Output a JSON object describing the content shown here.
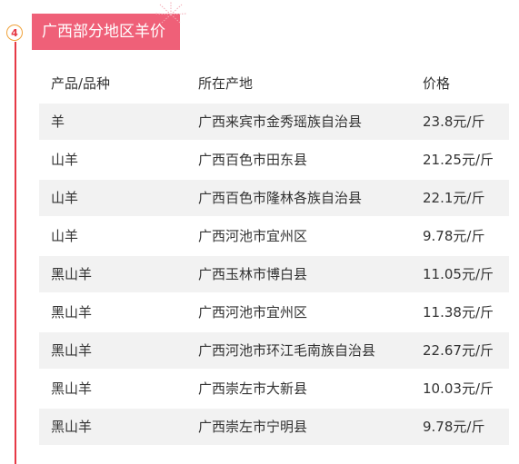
{
  "step": {
    "number": "4"
  },
  "section": {
    "title": "广西部分地区羊价"
  },
  "table": {
    "headers": [
      "产品/品种",
      "所在产地",
      "价格"
    ],
    "rows": [
      [
        "羊",
        "广西来宾市金秀瑶族自治县",
        "23.8元/斤"
      ],
      [
        "山羊",
        "广西百色市田东县",
        "21.25元/斤"
      ],
      [
        "山羊",
        "广西百色市隆林各族自治县",
        "22.1元/斤"
      ],
      [
        "山羊",
        "广西河池市宜州区",
        "9.78元/斤"
      ],
      [
        "黑山羊",
        "广西玉林市博白县",
        "11.05元/斤"
      ],
      [
        "黑山羊",
        "广西河池市宜州区",
        "11.38元/斤"
      ],
      [
        "黑山羊",
        "广西河池市环江毛南族自治县",
        "22.67元/斤"
      ],
      [
        "黑山羊",
        "广西崇左市大新县",
        "10.03元/斤"
      ],
      [
        "黑山羊",
        "广西崇左市宁明县",
        "9.78元/斤"
      ]
    ]
  },
  "colors": {
    "title_background": "#ef6078",
    "timeline": "#e63946",
    "row_shade": "#f2f2f2"
  }
}
